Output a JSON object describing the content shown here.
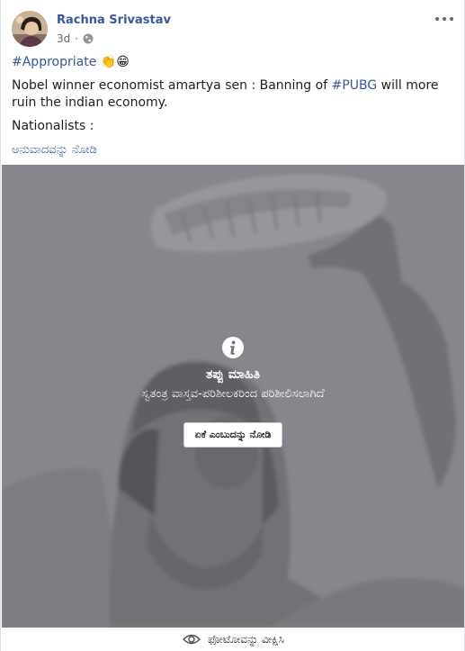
{
  "post": {
    "author": "Rachna Srivastav",
    "time": "3d",
    "dot": "·",
    "hashtag_line": "#Appropriate",
    "hashtag_emoji": "👏😁",
    "body_prefix": "Nobel winner economist amartya sen : Banning of ",
    "body_hashtag": "#PUBG",
    "body_suffix": " will more ruin the indian economy.",
    "second_line": "Nationalists :",
    "translate_link": "ಅನುವಾದವನ್ನು ನೋಡಿ"
  },
  "warning": {
    "title": "ತಪ್ಪು ಮಾಹಿತಿ",
    "subtitle": "ಸ್ವತಂತ್ರ ವಾಸ್ತವ-ಪರಿಶೀಲಕರಿಂದ ಪರಿಶೀಲಿಸಲಾಗಿದೆ",
    "button": "ಏಕೆ ಎಂಬುದನ್ನು ನೋಡಿ"
  },
  "footer": {
    "see_photo": "ಫೋಟೋವನ್ನು ವೀಕ್ಷಿಸಿ"
  },
  "icons": {
    "more": "more-options-icon",
    "globe": "globe-icon",
    "info": "info-icon",
    "eye": "eye-icon"
  }
}
